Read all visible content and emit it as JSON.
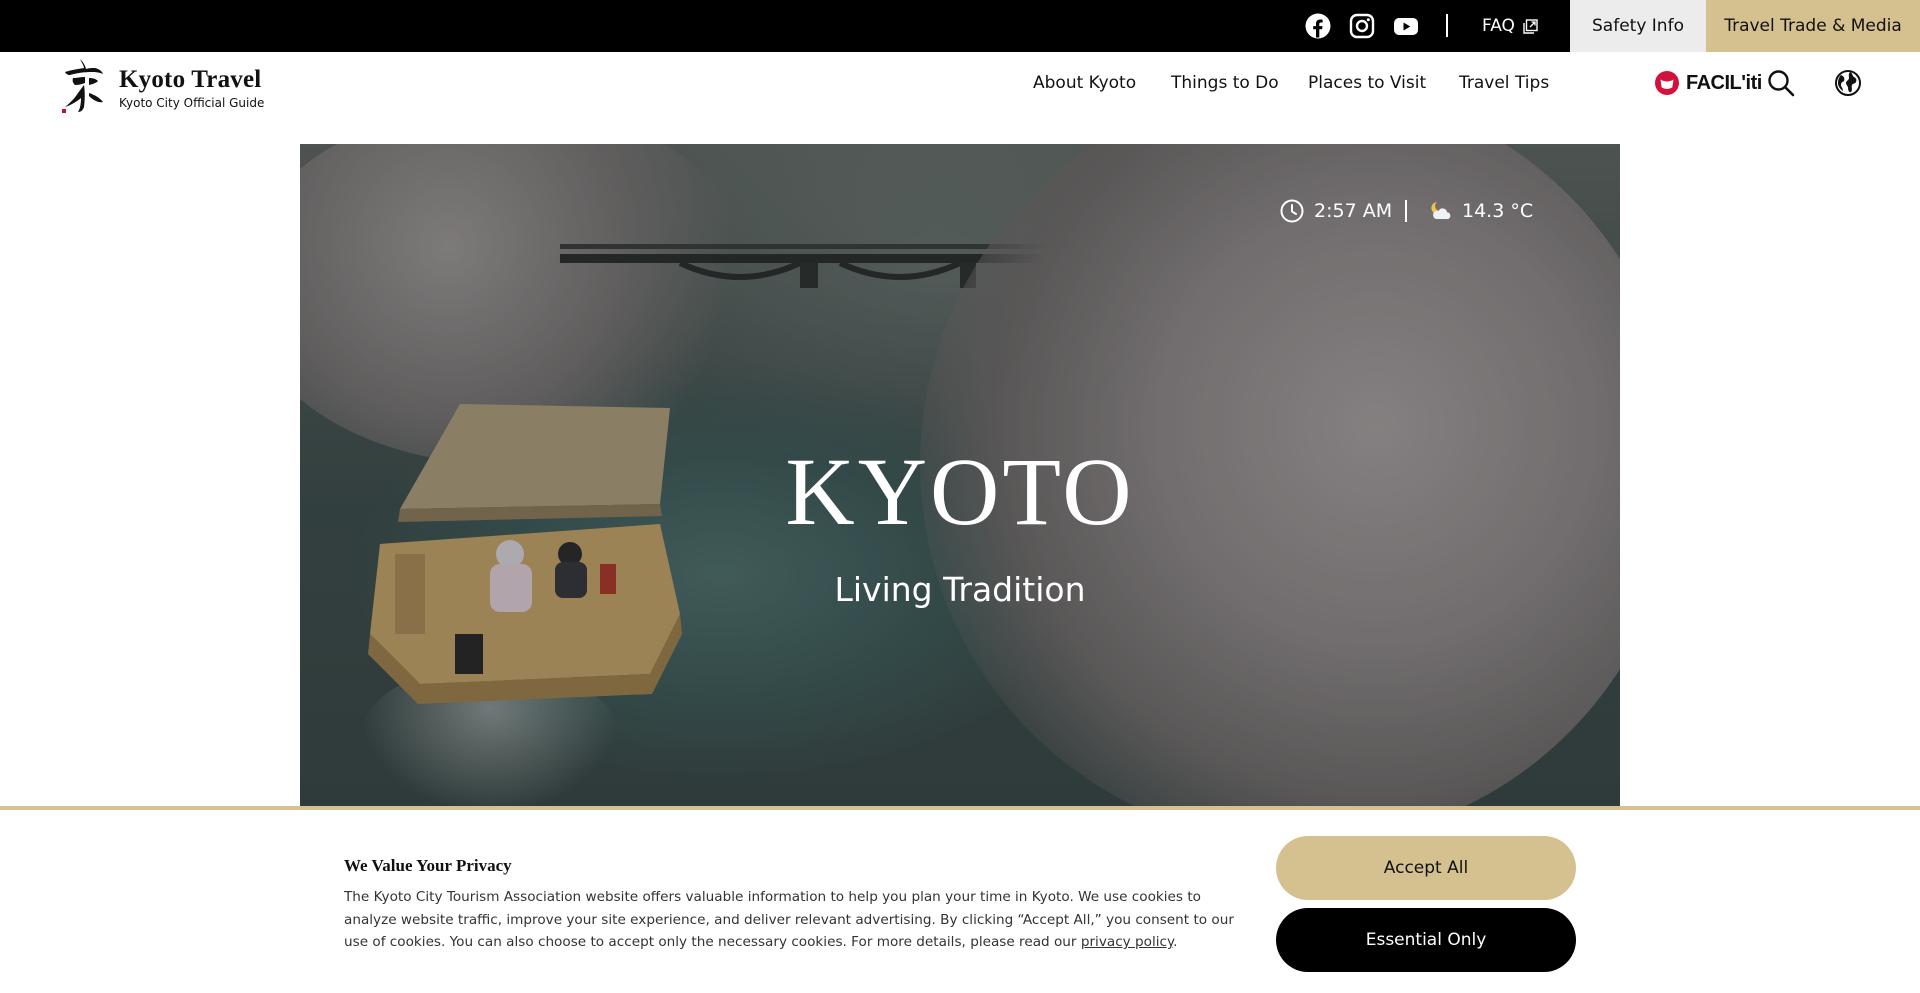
{
  "topbar": {
    "social": [
      "facebook-icon",
      "instagram-icon",
      "youtube-icon"
    ],
    "faq_label": "FAQ",
    "safety_label": "Safety Info",
    "trade_label": "Travel Trade & Media"
  },
  "header": {
    "logo_title": "Kyoto Travel",
    "logo_subtitle": "Kyoto City Official Guide",
    "nav": [
      "About Kyoto",
      "Things to Do",
      "Places to Visit",
      "Travel Tips"
    ],
    "facil_label": "FACIL'iti",
    "icons": [
      "search-icon",
      "globe-icon"
    ]
  },
  "hero": {
    "time": "2:57 AM",
    "temperature": "14.3 °C",
    "weather_icon": "partly-cloudy-night-icon",
    "title": "KYOTO",
    "subtitle": "Living Tradition"
  },
  "cookie": {
    "title": "We Value Your Privacy",
    "text": "The Kyoto City Tourism Association website offers valuable information to help you plan your time in Kyoto. We use cookies to analyze website traffic, improve your site experience, and deliver relevant advertising. By clicking “Accept All,” you consent to our use of cookies. You can also choose to accept only the necessary cookies. For more details, please read our ",
    "link": "privacy policy",
    "text_end": ".",
    "accept_label": "Accept All",
    "essential_label": "Essential Only"
  },
  "colors": {
    "accent_gold": "#d4c18f",
    "topbar_bg": "#000000",
    "safety_bg": "#ececec"
  }
}
